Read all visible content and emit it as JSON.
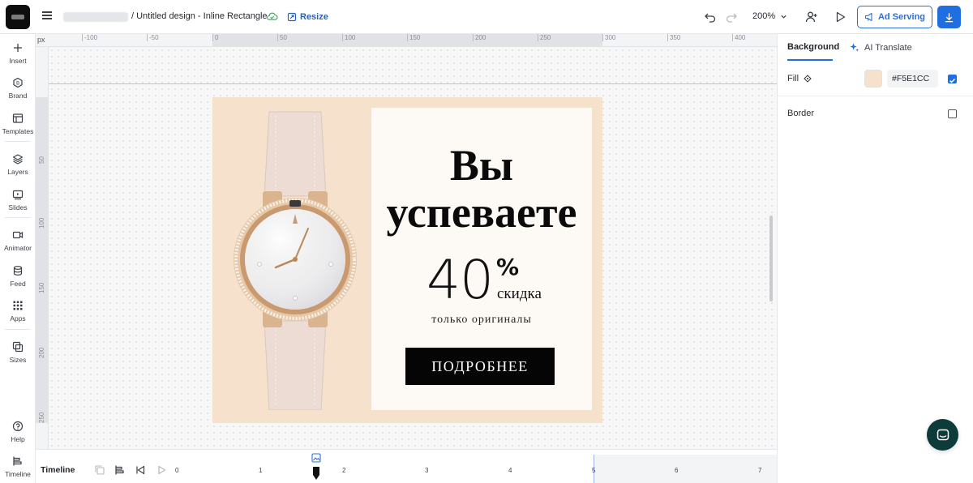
{
  "header": {
    "breadcrumb": "/ Untitled design - Inline Rectangle",
    "resize_label": "Resize",
    "zoom_label": "200%",
    "ad_serving_label": "Ad Serving"
  },
  "sidebar": {
    "items": [
      {
        "label": "Insert",
        "icon": "plus-icon"
      },
      {
        "label": "Brand",
        "icon": "brand-icon"
      },
      {
        "label": "Templates",
        "icon": "templates-icon"
      },
      {
        "label": "Layers",
        "icon": "layers-icon"
      },
      {
        "label": "Slides",
        "icon": "slides-icon"
      },
      {
        "label": "Animator",
        "icon": "animator-icon"
      },
      {
        "label": "Feed",
        "icon": "feed-icon"
      },
      {
        "label": "Apps",
        "icon": "apps-icon"
      },
      {
        "label": "Sizes",
        "icon": "sizes-icon"
      },
      {
        "label": "Help",
        "icon": "help-icon"
      },
      {
        "label": "Timeline",
        "icon": "timeline-icon"
      }
    ]
  },
  "canvas": {
    "unit_label": "px",
    "ruler_top": [
      "-100",
      "-50",
      "0",
      "50",
      "100",
      "150",
      "200",
      "250",
      "300",
      "350",
      "400"
    ],
    "ruler_left": [
      "50",
      "100",
      "150",
      "200",
      "250"
    ]
  },
  "design": {
    "background_color": "#F5E1CC",
    "headline": "Вы успеваете",
    "discount_number": "40",
    "discount_sign": "%",
    "discount_word": "скидка",
    "subtext": "только оригиналы",
    "cta_label": "ПОДРОБНЕЕ"
  },
  "properties": {
    "tab_background": "Background",
    "tab_ai_translate": "AI Translate",
    "fill_label": "Fill",
    "fill_value": "#F5E1CC",
    "fill_enabled": true,
    "border_label": "Border",
    "border_enabled": false
  },
  "timeline": {
    "label": "Timeline",
    "scale": [
      "0",
      "1",
      "2",
      "3",
      "4",
      "5",
      "6",
      "7"
    ]
  },
  "colors": {
    "accent": "#1f6fe0",
    "chat": "#0d3b3a"
  }
}
